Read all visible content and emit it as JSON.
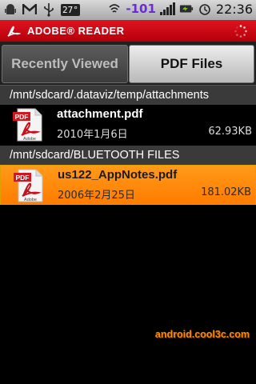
{
  "status_bar": {
    "icons": [
      "android-icon",
      "gmail-icon",
      "usb-icon"
    ],
    "temperature": "27°",
    "signal_value": "-101",
    "time": "22:36"
  },
  "app": {
    "title": "ADOBE® READER"
  },
  "tabs": [
    {
      "label": "Recently Viewed",
      "active": false
    },
    {
      "label": "PDF Files",
      "active": true
    }
  ],
  "sections": [
    {
      "path": "/mnt/sdcard/.dataviz/temp/attachments",
      "files": [
        {
          "name": "attachment.pdf",
          "date": "2010年1月6日",
          "size": "62.93KB",
          "selected": false
        }
      ]
    },
    {
      "path": "/mnt/sdcard/BLUETOOTH FILES",
      "files": [
        {
          "name": "us122_AppNotes.pdf",
          "date": "2006年2月25日",
          "size": "181.02KB",
          "selected": true
        }
      ]
    }
  ],
  "pdf_icon_label": "Adobe",
  "pdf_badge": "PDF",
  "watermark": "android.cool3c.com",
  "colors": {
    "header_red": "#d10a16",
    "selection_orange": "#ff8c00",
    "signal_purple": "#6b2bd6"
  }
}
